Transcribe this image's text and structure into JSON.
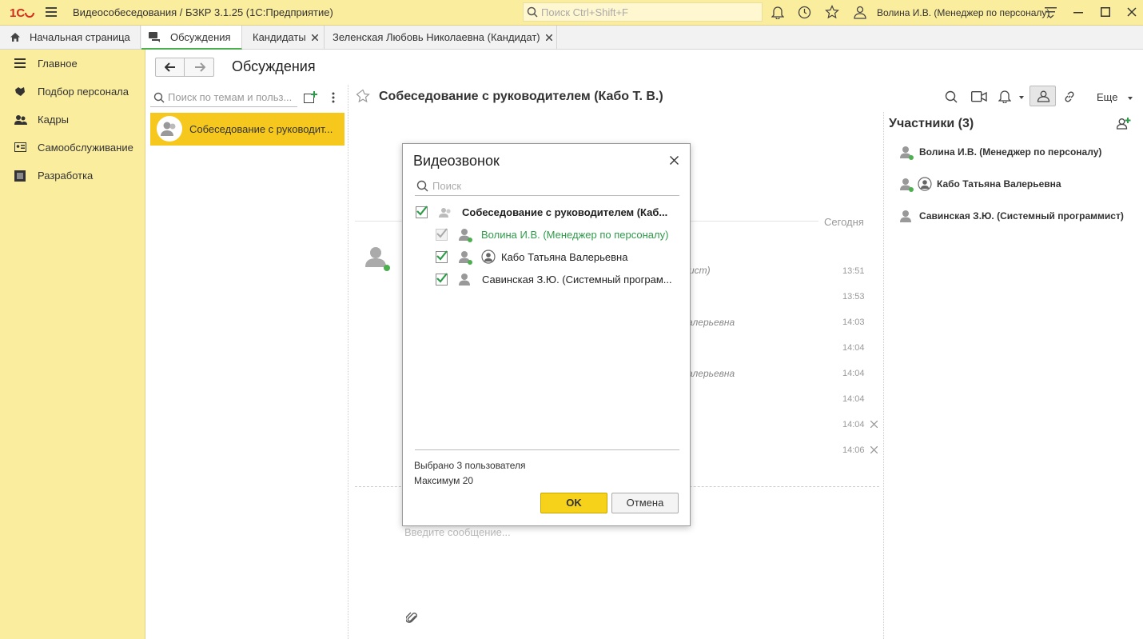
{
  "window": {
    "title": "Видеособеседования / БЗКР 3.1.25  (1С:Предприятие)",
    "search_placeholder": "Поиск Ctrl+Shift+F",
    "user": "Волина И.В. (Менеджер по персоналу)"
  },
  "tabs": [
    {
      "label": "Начальная страница"
    },
    {
      "label": "Обсуждения"
    },
    {
      "label": "Кандидаты"
    },
    {
      "label": "Зеленская Любовь Николаевна (Кандидат)"
    }
  ],
  "sidebar": {
    "items": [
      {
        "label": "Главное"
      },
      {
        "label": "Подбор персонала"
      },
      {
        "label": "Кадры"
      },
      {
        "label": "Самообслуживание"
      },
      {
        "label": "Разработка"
      }
    ]
  },
  "page": {
    "title": "Обсуждения",
    "topic_search_placeholder": "Поиск по темам и польз...",
    "topic_item": "Собеседование с руководит...",
    "conversation_title": "Собеседование с руководителем (Кабо Т. В.)",
    "more_label": "Еще",
    "day_label": "Сегодня",
    "message_placeholder": "Введите сообщение..."
  },
  "messages": {
    "times": [
      "13:51",
      "13:53",
      "14:03",
      "14:04",
      "14:04",
      "14:04",
      "14:04",
      "14:06"
    ],
    "fragments": [
      "ист)",
      "алерьевна",
      "алерьевна"
    ]
  },
  "participants": {
    "header": "Участники (3)",
    "items": [
      {
        "name": "Волина И.В. (Менеджер по персоналу)"
      },
      {
        "name": "Кабо Татьяна Валерьевна"
      },
      {
        "name": "Савинская З.Ю. (Системный программист)"
      }
    ]
  },
  "dialog": {
    "title": "Видеозвонок",
    "search_placeholder": "Поиск",
    "group": "Собеседование с руководителем (Каб...",
    "members": [
      {
        "name": "Волина И.В. (Менеджер по персоналу)"
      },
      {
        "name": "Кабо Татьяна Валерьевна"
      },
      {
        "name": "Савинская З.Ю. (Системный програм..."
      }
    ],
    "selected_text": "Выбрано 3 пользователя",
    "max_text": "Максимум 20",
    "ok_label": "OK",
    "cancel_label": "Отмена"
  },
  "colors": {
    "panel_yellow": "#fbed9e",
    "accent_yellow": "#f6c81d",
    "green": "#4caf50",
    "self_user_green": "#2e9b4a"
  }
}
